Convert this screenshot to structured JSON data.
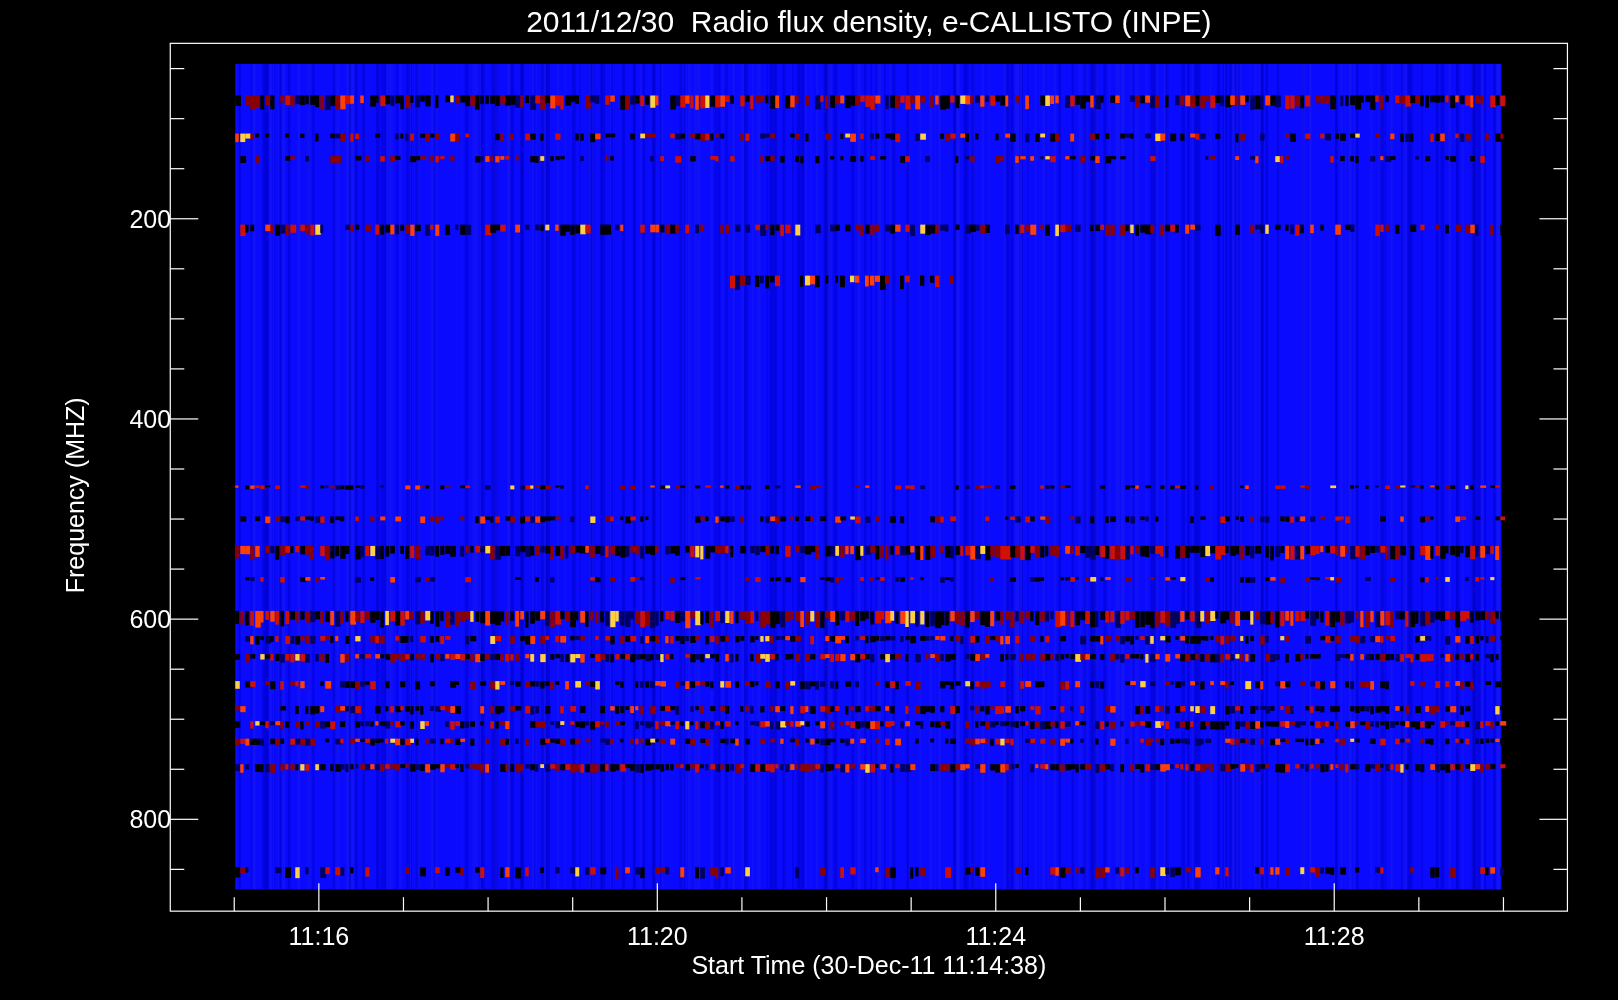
{
  "plot": {
    "title": "2011/12/30  Radio flux density, e-CALLISTO (INPE)",
    "xlabel": "Start Time (30-Dec-11 11:14:38)",
    "ylabel": "Frequency (MHZ)",
    "x_tick_labels": [
      "11:16",
      "11:20",
      "11:24",
      "11:28"
    ],
    "y_tick_labels": [
      "200",
      "400",
      "600",
      "800"
    ]
  }
}
